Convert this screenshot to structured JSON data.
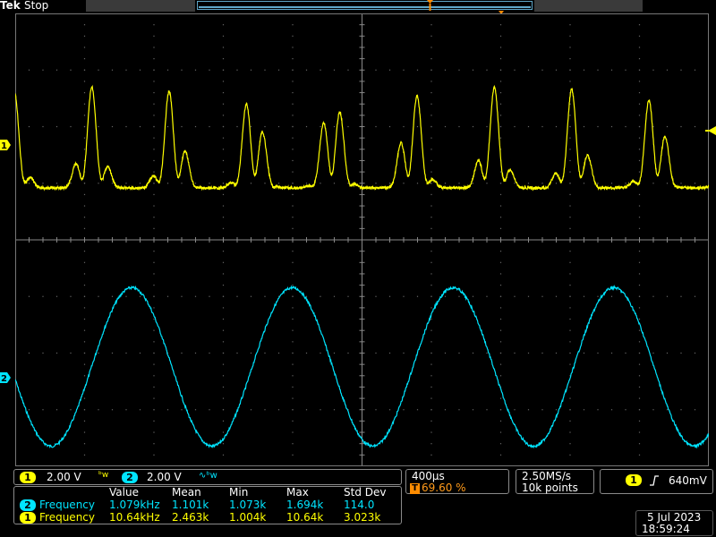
{
  "header": {
    "brand": "Tek",
    "status": "Stop"
  },
  "channels": {
    "ch1": {
      "label": "1",
      "scale": "2.00 V",
      "color": "#ffff00"
    },
    "ch2": {
      "label": "2",
      "scale": "2.00 V",
      "color": "#00e5ff"
    }
  },
  "timebase": {
    "scale": "400µs",
    "trigger_position": "69.60 %",
    "trigger_icon": "T"
  },
  "acquisition": {
    "sample_rate": "2.50MS/s",
    "record_length": "10k points"
  },
  "trigger": {
    "source": "1",
    "level": "640mV",
    "slope_icon": "rising-edge-icon"
  },
  "measurements": {
    "headers": [
      "Value",
      "Mean",
      "Min",
      "Max",
      "Std Dev"
    ],
    "rows": [
      {
        "channel": "2",
        "name": "Frequency",
        "values": [
          "1.079kHz",
          "1.101k",
          "1.073k",
          "1.694k",
          "114.0"
        ]
      },
      {
        "channel": "1",
        "name": "Frequency",
        "values": [
          "10.64kHz",
          "2.463k",
          "1.004k",
          "10.64k",
          "3.023k"
        ]
      }
    ]
  },
  "datetime": {
    "date": "5 Jul  2023",
    "time": "18:59:24"
  },
  "waveforms": {
    "ch2_frequency_khz": 1.079,
    "ch2_amplitude_div": 1.0,
    "ch1_burst_frequency_khz": 10.64,
    "ch1_amplitude_div": 1.0
  }
}
